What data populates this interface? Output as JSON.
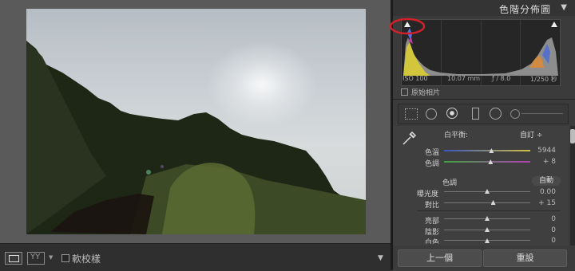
{
  "panel": {
    "title": "色階分佈圖",
    "exif": {
      "iso": "ISO 100",
      "focal": "10.07 mm",
      "aperture": "ƒ / 8.0",
      "shutter": "1/250 秒"
    },
    "original_photo_label": "原始相片"
  },
  "basic": {
    "wb_label": "白平衡:",
    "wb_value": "自訂 ÷",
    "temp": {
      "label": "色溫",
      "value": "5944",
      "level": 0.55
    },
    "tint": {
      "label": "色調",
      "value": "+ 8",
      "level": 0.54
    },
    "tone_label": "色調",
    "auto_label": "自動",
    "exposure": {
      "label": "曝光度",
      "value": "0.00",
      "level": 0.5
    },
    "contrast": {
      "label": "對比",
      "value": "+ 15",
      "level": 0.57
    },
    "highlights": {
      "label": "亮部",
      "value": "0",
      "level": 0.5
    },
    "shadows": {
      "label": "陰影",
      "value": "0",
      "level": 0.5
    },
    "whites": {
      "label": "白色",
      "value": "0",
      "level": 0.5
    }
  },
  "bottom_buttons": {
    "previous": "上一個",
    "reset": "重設"
  },
  "toolbar": {
    "soft_proof": "軟校樣"
  },
  "colors": {
    "accent_red": "#d0202a",
    "panel_bg": "#3b3b3b"
  }
}
